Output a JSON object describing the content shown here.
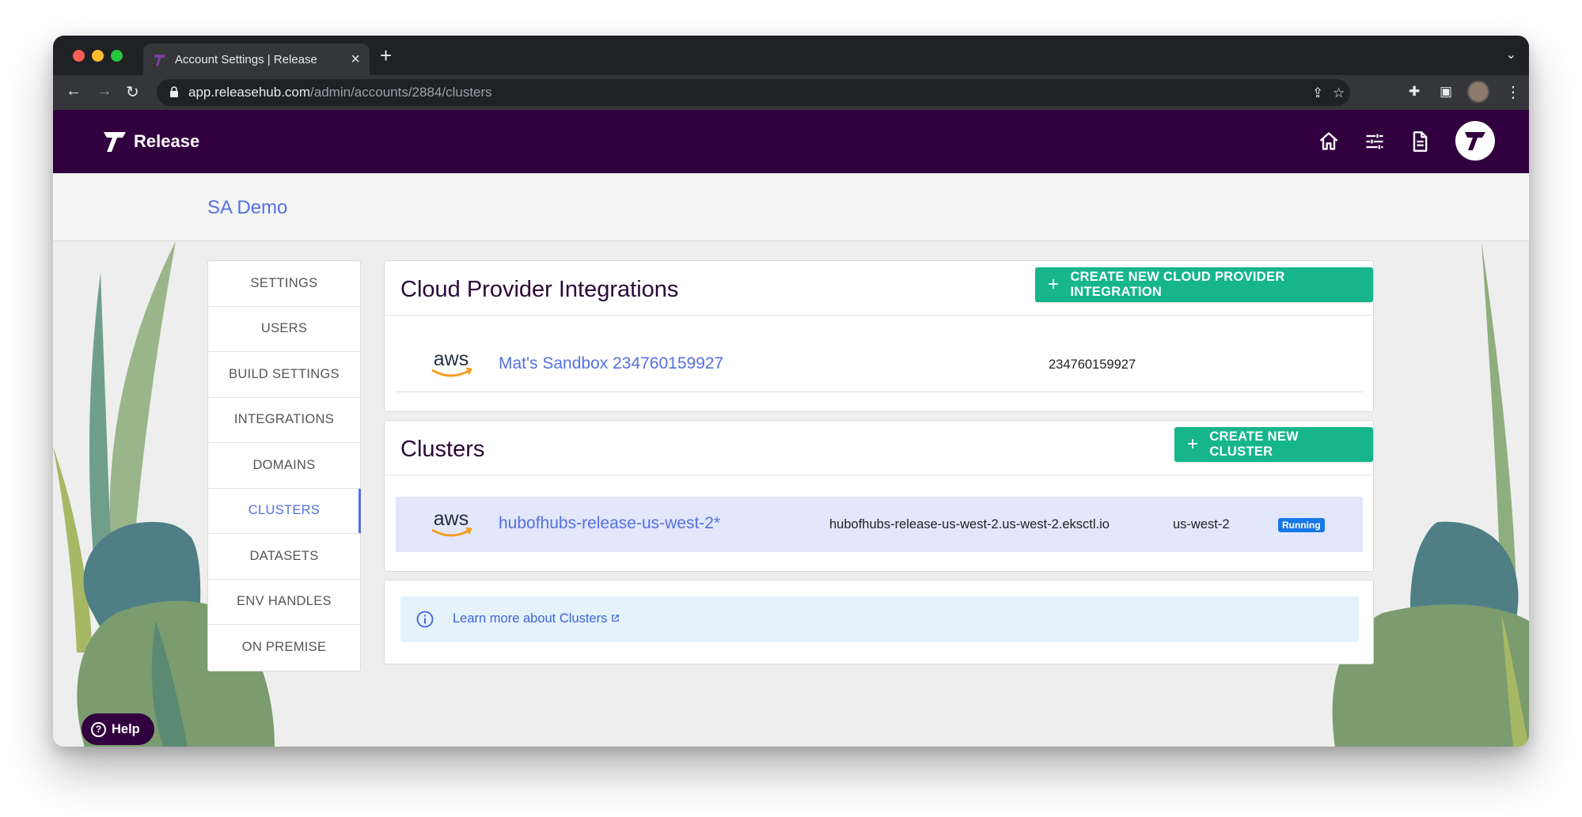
{
  "browser": {
    "tab_title": "Account Settings | Release",
    "url_host": "app.releasehub.com",
    "url_path": "/admin/accounts/2884/clusters",
    "new_tab": "+",
    "tab_close": "×"
  },
  "header": {
    "brand_name": "Release"
  },
  "account": {
    "name": "SA Demo"
  },
  "sidebar": {
    "items": [
      {
        "label": "SETTINGS",
        "active": false
      },
      {
        "label": "USERS",
        "active": false
      },
      {
        "label": "BUILD SETTINGS",
        "active": false
      },
      {
        "label": "INTEGRATIONS",
        "active": false
      },
      {
        "label": "DOMAINS",
        "active": false
      },
      {
        "label": "CLUSTERS",
        "active": true
      },
      {
        "label": "DATASETS",
        "active": false
      },
      {
        "label": "ENV HANDLES",
        "active": false
      },
      {
        "label": "ON PREMISE",
        "active": false
      }
    ]
  },
  "cloud_providers": {
    "title": "Cloud Provider Integrations",
    "create_label": "CREATE NEW CLOUD PROVIDER INTEGRATION",
    "rows": [
      {
        "provider": "aws",
        "name": "Mat's Sandbox 234760159927",
        "account_id": "234760159927"
      }
    ]
  },
  "clusters": {
    "title": "Clusters",
    "create_label": "CREATE NEW CLUSTER",
    "rows": [
      {
        "provider": "aws",
        "name": "hubofhubs-release-us-west-2*",
        "endpoint": "hubofhubs-release-us-west-2.us-west-2.eksctl.io",
        "region": "us-west-2",
        "status": "Running"
      }
    ]
  },
  "info": {
    "link_text": "Learn more about Clusters"
  },
  "help": {
    "label": "Help"
  },
  "colors": {
    "brand_purple": "#32003f",
    "accent_blue": "#5470e0",
    "button_green": "#16b58b",
    "status_blue": "#1877e6",
    "selected_row": "#e2e7fc"
  }
}
